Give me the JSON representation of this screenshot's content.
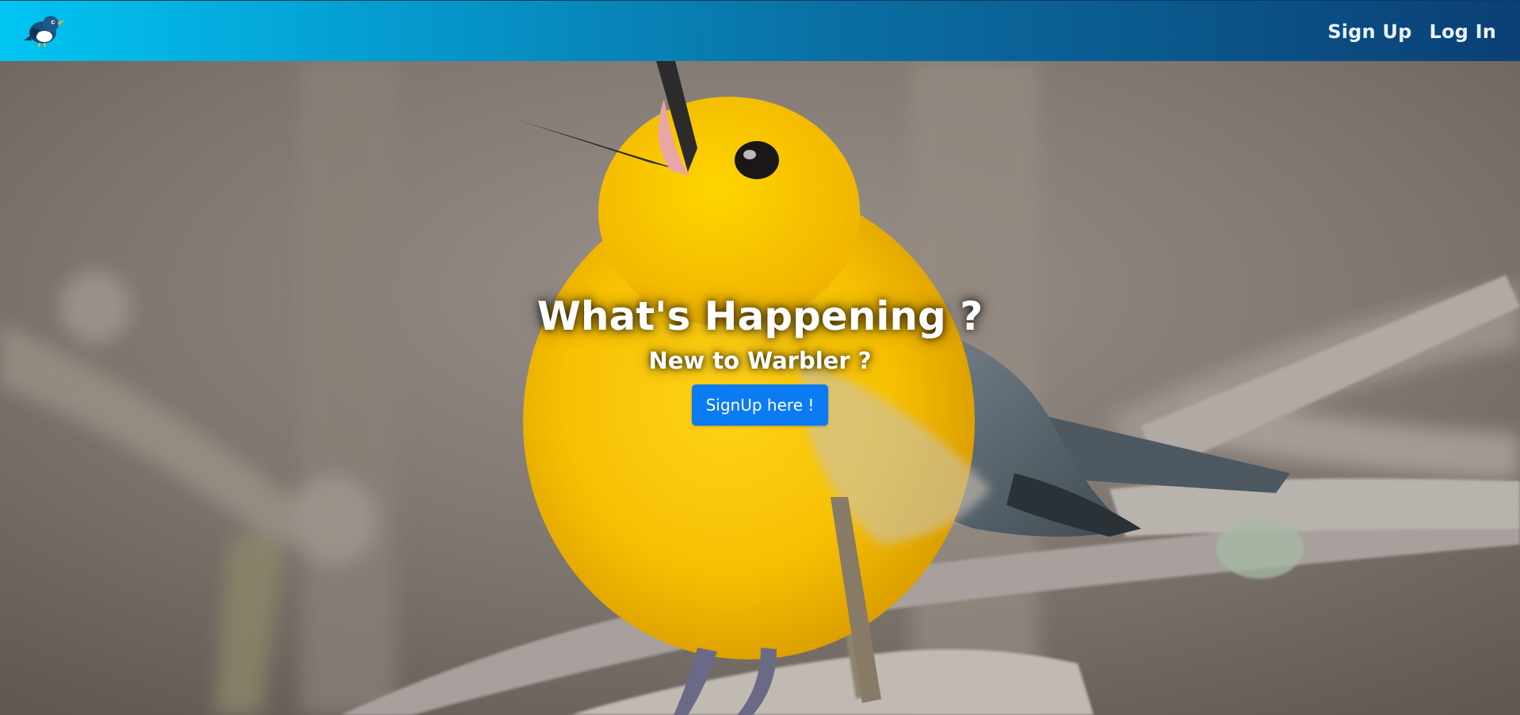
{
  "navbar": {
    "logo_icon": "warbler-bird-logo-icon",
    "links": [
      {
        "label": "Sign Up"
      },
      {
        "label": "Log In"
      }
    ],
    "gradient": [
      "#02c5f2",
      "#0b3f75"
    ]
  },
  "hero": {
    "background_icon": "yellow-warbler-photo",
    "title": "What's Happening ?",
    "subtitle": "New to Warbler ?",
    "cta_label": "SignUp here !",
    "accent_color": "#0b7bf3"
  }
}
